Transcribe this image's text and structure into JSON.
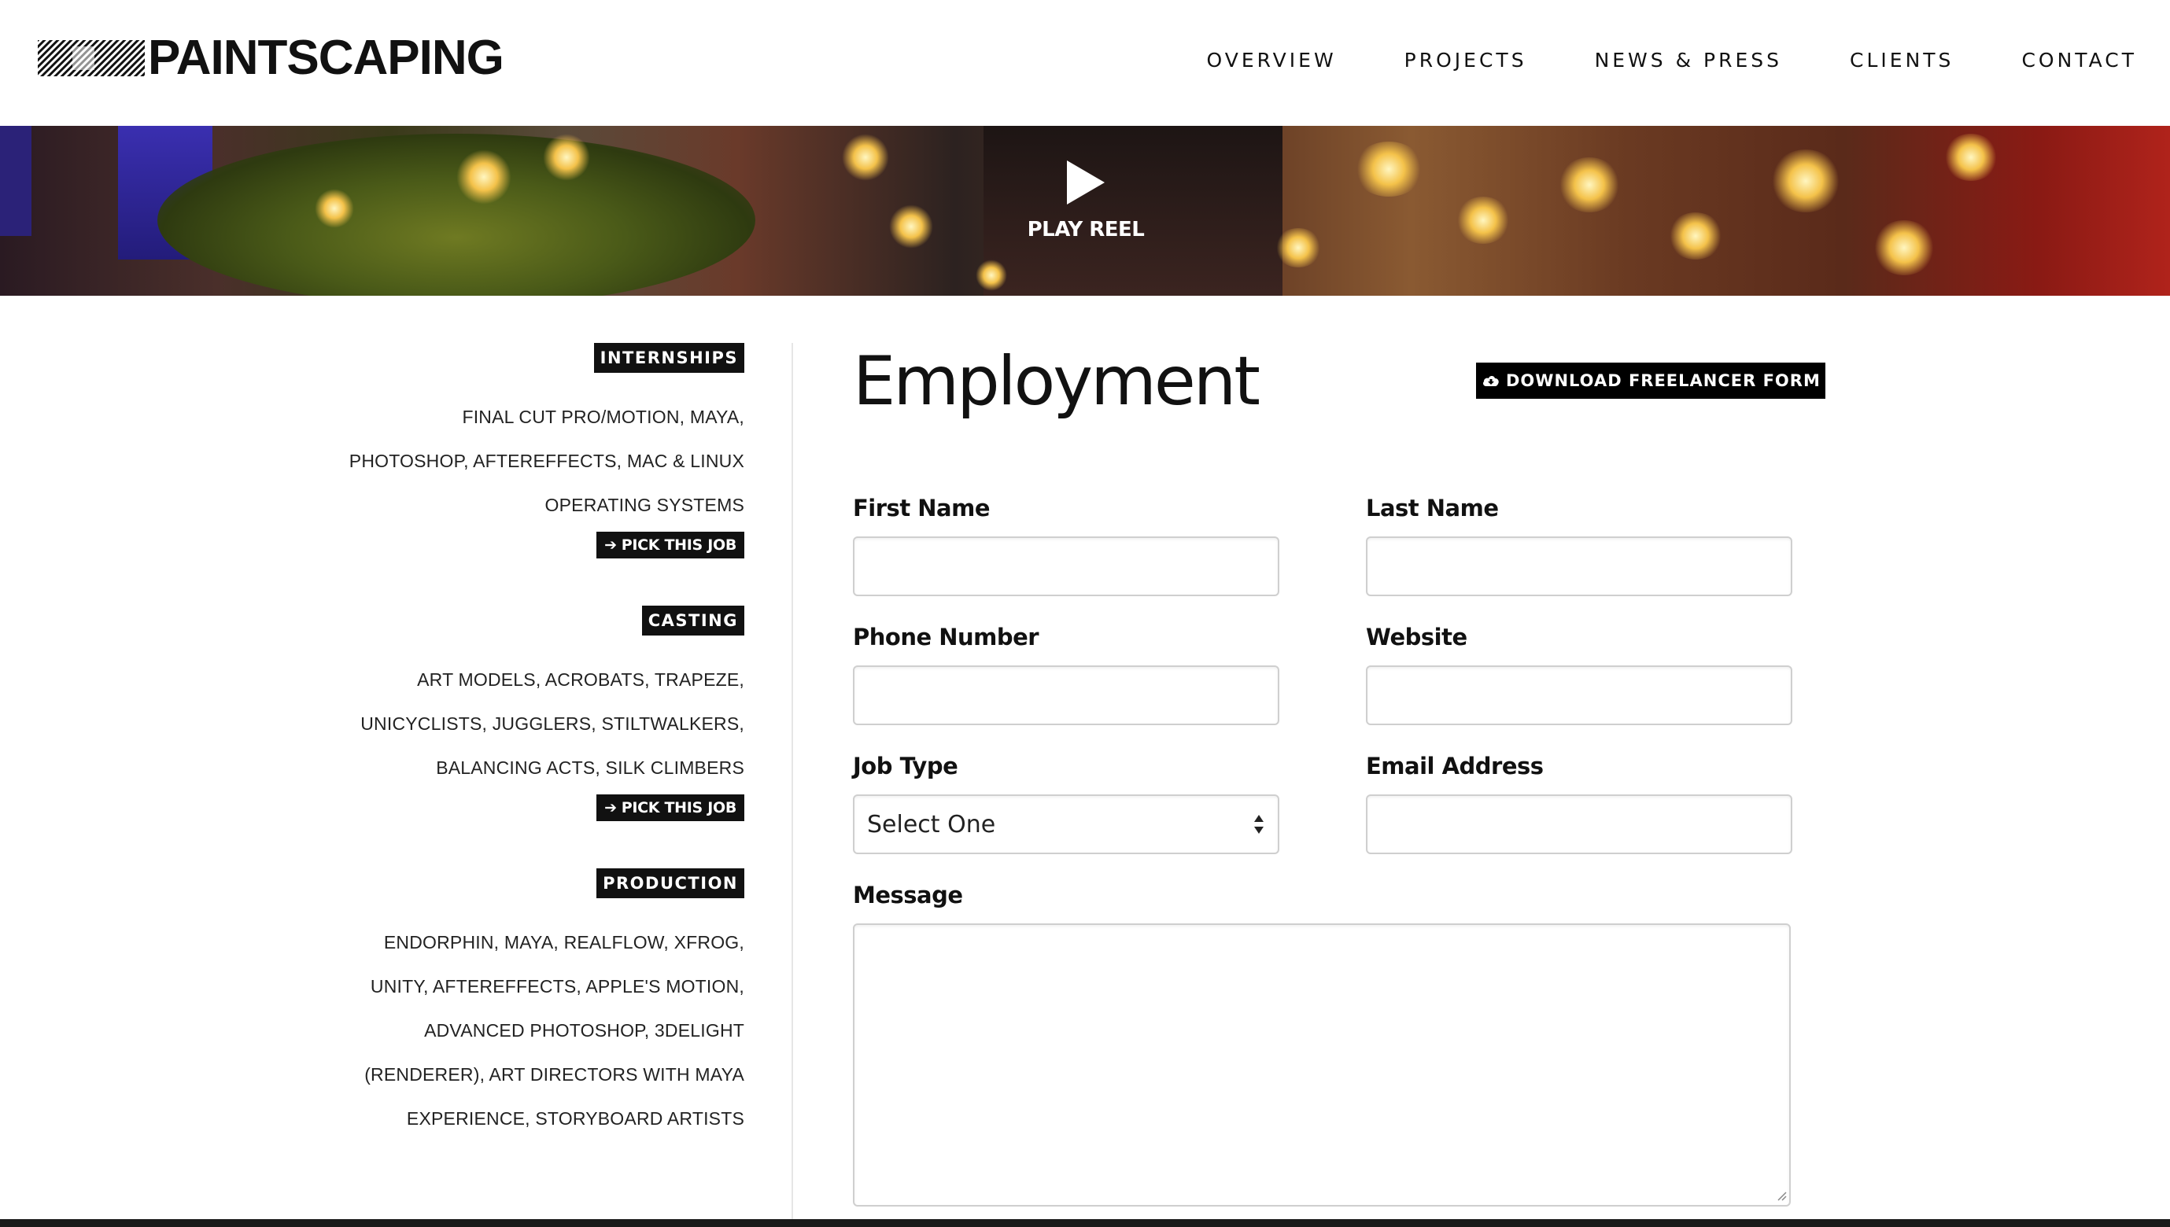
{
  "brand": {
    "name": "PAINTSCAPING",
    "logo_icon": "striped-logo-mark"
  },
  "nav": {
    "items": [
      {
        "label": "OVERVIEW"
      },
      {
        "label": "PROJECTS"
      },
      {
        "label": "NEWS & PRESS"
      },
      {
        "label": "CLIENTS"
      },
      {
        "label": "CONTACT"
      }
    ]
  },
  "hero": {
    "play_label": "PLAY REEL",
    "play_icon": "play-icon"
  },
  "jobs": [
    {
      "badge": "INTERNSHIPS",
      "lines": [
        "FINAL CUT PRO/MOTION, MAYA,",
        "PHOTOSHOP, AFTEREFFECTS, MAC & LINUX",
        "OPERATING SYSTEMS"
      ],
      "pick_label": "PICK THIS JOB"
    },
    {
      "badge": "CASTING",
      "lines": [
        "ART MODELS, ACROBATS, TRAPEZE,",
        "UNICYCLISTS, JUGGLERS, STILTWALKERS,",
        "BALANCING ACTS, SILK CLIMBERS"
      ],
      "pick_label": "PICK THIS JOB"
    },
    {
      "badge": "PRODUCTION",
      "lines": [
        "ENDORPHIN, MAYA, REALFLOW, XFROG,",
        "UNITY, AFTEREFFECTS, APPLE'S MOTION,",
        "ADVANCED PHOTOSHOP, 3DELIGHT",
        "(RENDERER), ART DIRECTORS WITH MAYA",
        "EXPERIENCE, STORYBOARD ARTISTS"
      ]
    }
  ],
  "main": {
    "title": "Employment",
    "download_label": "DOWNLOAD FREELANCER FORM",
    "download_icon": "cloud-download-icon"
  },
  "form": {
    "first_name": {
      "label": "First Name",
      "value": ""
    },
    "last_name": {
      "label": "Last Name",
      "value": ""
    },
    "phone": {
      "label": "Phone Number",
      "value": ""
    },
    "website": {
      "label": "Website",
      "value": ""
    },
    "job_type": {
      "label": "Job Type",
      "selected": "Select One"
    },
    "email": {
      "label": "Email Address",
      "value": ""
    },
    "message": {
      "label": "Message",
      "value": ""
    }
  }
}
